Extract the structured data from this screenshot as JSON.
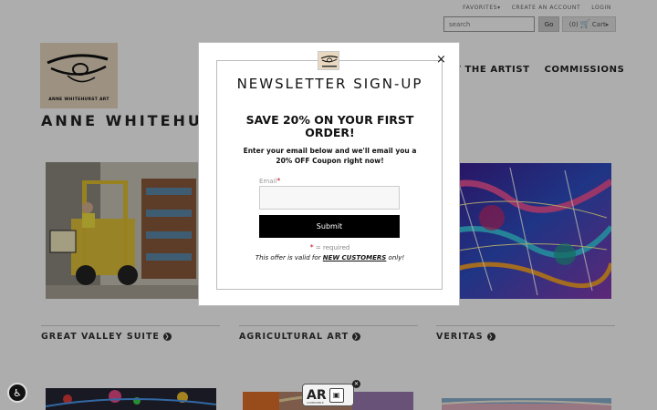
{
  "header": {
    "links": [
      "FAVORITES▾",
      "CREATE AN ACCOUNT",
      "LOGIN"
    ],
    "search_placeholder": "search",
    "go_label": "Go",
    "cart_count": "(0)",
    "cart_label": "Cart▸"
  },
  "logo": {
    "text": "ANNE WHITEHURST ART"
  },
  "nav": {
    "items": [
      "T THE ARTIST",
      "COMMISSIONS"
    ]
  },
  "site": {
    "title": "ANNE WHITEHUR"
  },
  "categories": [
    {
      "label": "GREAT VALLEY SUITE"
    },
    {
      "label": "AGRICULTURAL ART"
    },
    {
      "label": "VERITAS"
    }
  ],
  "ar_badge": {
    "text": "AR",
    "sub": "COMPATIBLE"
  },
  "modal": {
    "title": "NEWSLETTER SIGN-UP",
    "subtitle": "SAVE 20% ON YOUR FIRST ORDER!",
    "description": "Enter your email below and we'll email you a 20% OFF Coupon right now!",
    "email_label": "Email",
    "email_value": "",
    "submit_label": "Submit",
    "required_note": "= required",
    "offer_prefix": "This offer is valid for ",
    "offer_emphasis": "NEW CUSTOMERS",
    "offer_suffix": " only!",
    "close_icon": "×"
  },
  "colors": {
    "overlay": "rgba(0,0,0,0.32)",
    "submit_bg": "#000000",
    "required": "#c8102e"
  }
}
